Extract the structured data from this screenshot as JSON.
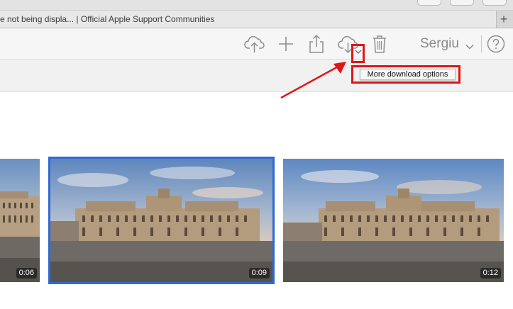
{
  "browser": {
    "tab_title": "e not being displa... | Official Apple Support Communities",
    "new_tab_label": "+"
  },
  "toolbar": {
    "icons": [
      "upload-cloud-icon",
      "add-icon",
      "share-icon",
      "download-cloud-icon",
      "trash-icon",
      "help-icon"
    ],
    "account_name": "Sergiu"
  },
  "tooltip": {
    "text": "More download options"
  },
  "thumbnails": [
    {
      "duration": "0:06",
      "selected": false
    },
    {
      "duration": "0:09",
      "selected": true
    },
    {
      "duration": "0:12",
      "selected": false
    }
  ],
  "colors": {
    "annotation_red": "#e01616",
    "selection_blue": "#2d6ad6"
  }
}
